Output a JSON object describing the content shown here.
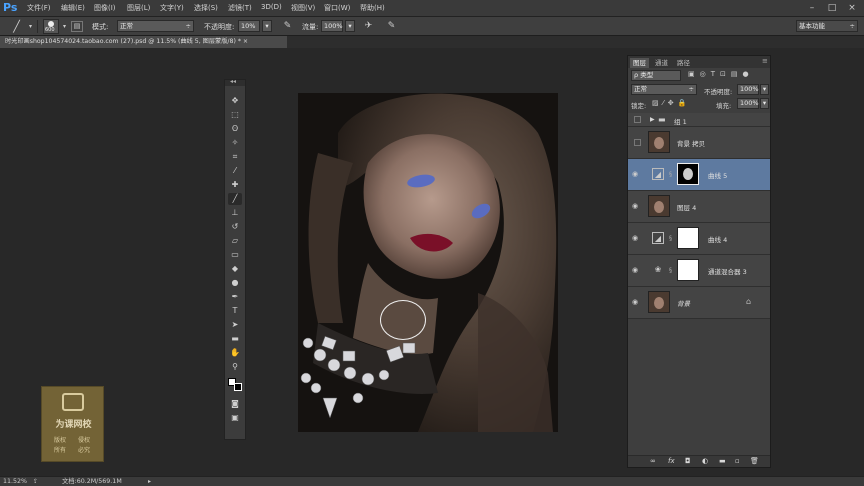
{
  "app": {
    "logo": "Ps",
    "workspace": "基本功能"
  },
  "menu": [
    "文件(F)",
    "编辑(E)",
    "图像(I)",
    "图层(L)",
    "文字(Y)",
    "选择(S)",
    "滤镜(T)",
    "3D(D)",
    "视图(V)",
    "窗口(W)",
    "帮助(H)"
  ],
  "window_controls": [
    "–",
    "□",
    "×"
  ],
  "options": {
    "brush_size": "600",
    "mode_label": "模式:",
    "mode_value": "正常",
    "opacity_label": "不透明度:",
    "opacity_value": "10%",
    "flow_label": "流量:",
    "flow_value": "100%"
  },
  "document": {
    "tab_title": "时光印画shop104574024.taobao.com (27).psd @ 11.5% (曲线 5, 图层蒙版/8) *",
    "close": "×"
  },
  "layers_panel": {
    "tabs": [
      "图层",
      "通道",
      "路径"
    ],
    "filter_kind": "ρ 类型",
    "blend_mode": "正常",
    "opacity_label": "不透明度:",
    "opacity_value": "100%",
    "lock_label": "锁定:",
    "fill_label": "填充:",
    "fill_value": "100%",
    "group_name": "组 1",
    "layers": [
      {
        "name": "背景 拷贝",
        "visible": false,
        "type": "image"
      },
      {
        "name": "曲线 5",
        "visible": true,
        "type": "curves",
        "selected": true
      },
      {
        "name": "图层 4",
        "visible": true,
        "type": "image"
      },
      {
        "name": "曲线 4",
        "visible": true,
        "type": "curves"
      },
      {
        "name": "通道混合器 3",
        "visible": true,
        "type": "mixer"
      },
      {
        "name": "背景",
        "visible": true,
        "type": "image",
        "locked": true
      }
    ],
    "footer_icons": [
      "link-icon",
      "fx-icon",
      "mask-icon",
      "adjustment-icon",
      "folder-icon",
      "new-layer-icon",
      "trash-icon"
    ]
  },
  "status": {
    "zoom": "11.52%",
    "doc_size": "文档:60.2M/569.1M"
  },
  "watermark": {
    "line1": "为课网校",
    "line2a": "版权",
    "line2b": "侵权",
    "line3a": "所有",
    "line3b": "必究"
  },
  "colors": {
    "accent": "#5e7aa0",
    "ps_blue": "#4aa3ff"
  }
}
